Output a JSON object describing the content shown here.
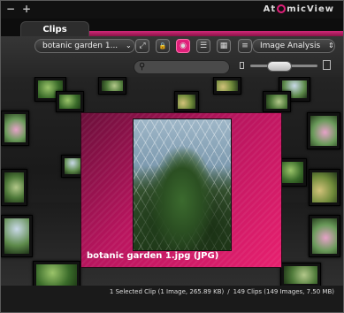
{
  "window": {
    "minimize_glyph": "−",
    "maximize_glyph": "+",
    "logo_text_left": "At",
    "logo_text_right": "micView"
  },
  "tabs": [
    {
      "label": "Clips",
      "active": true
    }
  ],
  "toolbar": {
    "collection_dropdown": {
      "value": "botanic garden 1...",
      "chevron": "⌄"
    },
    "view_dropdown": {
      "value": "Image Analysis",
      "chevron": "⇕"
    },
    "tools": [
      {
        "name": "fullscreen-icon",
        "glyph": "⤢"
      },
      {
        "name": "lock-icon",
        "glyph": "🔒"
      },
      {
        "name": "record-icon",
        "glyph": "◉"
      },
      {
        "name": "list-view-icon",
        "glyph": "☰"
      },
      {
        "name": "grid-view-icon",
        "glyph": "▦"
      },
      {
        "name": "align-left-icon",
        "glyph": "≡"
      }
    ],
    "search": {
      "placeholder": "",
      "value": ""
    },
    "zoom_level": 0.4
  },
  "preview": {
    "caption": "botanic garden 1.jpg (JPG)"
  },
  "status": {
    "selection": "1 Selected Clip (1 Image, 265.89 KB)",
    "separator": "/",
    "totals": "149 Clips (149 Images, 7.50 MB)"
  },
  "colors": {
    "accent": "#e0207a",
    "background": "#1b1b1b"
  }
}
